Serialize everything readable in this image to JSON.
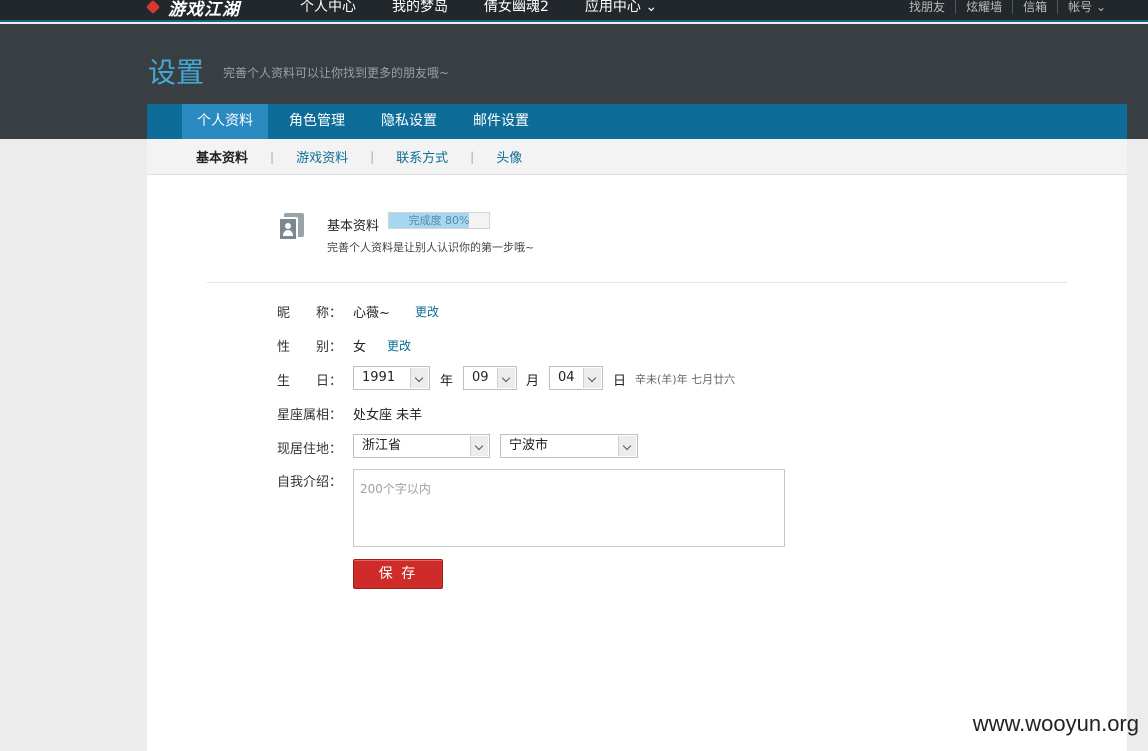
{
  "top": {
    "logo": "游戏江湖",
    "nav": [
      "个人中心",
      "我的梦岛",
      "倩女幽魂2",
      "应用中心"
    ],
    "links": [
      "找朋友",
      "炫耀墙",
      "信箱",
      "帐号"
    ]
  },
  "header": {
    "title": "设置",
    "subtitle": "完善个人资料可以让你找到更多的朋友哦~"
  },
  "tabs": [
    "个人资料",
    "角色管理",
    "隐私设置",
    "邮件设置"
  ],
  "subtabs": [
    "基本资料",
    "游戏资料",
    "联系方式",
    "头像"
  ],
  "section": {
    "title": "基本资料",
    "progress_label": "完成度 80%",
    "progress": 0.8,
    "desc": "完善个人资料是让别人认识你的第一步哦~"
  },
  "form": {
    "nickname_label": "昵　　称：",
    "nickname": "心薇~",
    "gender_label": "性　　别：",
    "gender": "女",
    "edit": "更改",
    "birthday_label": "生　　日：",
    "year": "1991",
    "year_unit": "年",
    "month": "09",
    "month_unit": "月",
    "day": "04",
    "day_unit": "日",
    "lunar": "辛未(羊)年 七月廿六",
    "zodiac_label": "星座属相：",
    "zodiac": "处女座 未羊",
    "residence_label": "现居住地：",
    "province": "浙江省",
    "city": "宁波市",
    "intro_label": "自我介绍：",
    "intro_placeholder": "200个字以内",
    "save": "保 存"
  },
  "watermark": "www.wooyun.org",
  "colors": {
    "accent": "#0d6d98",
    "title": "#41a9d6",
    "save": "#cf2c29"
  }
}
